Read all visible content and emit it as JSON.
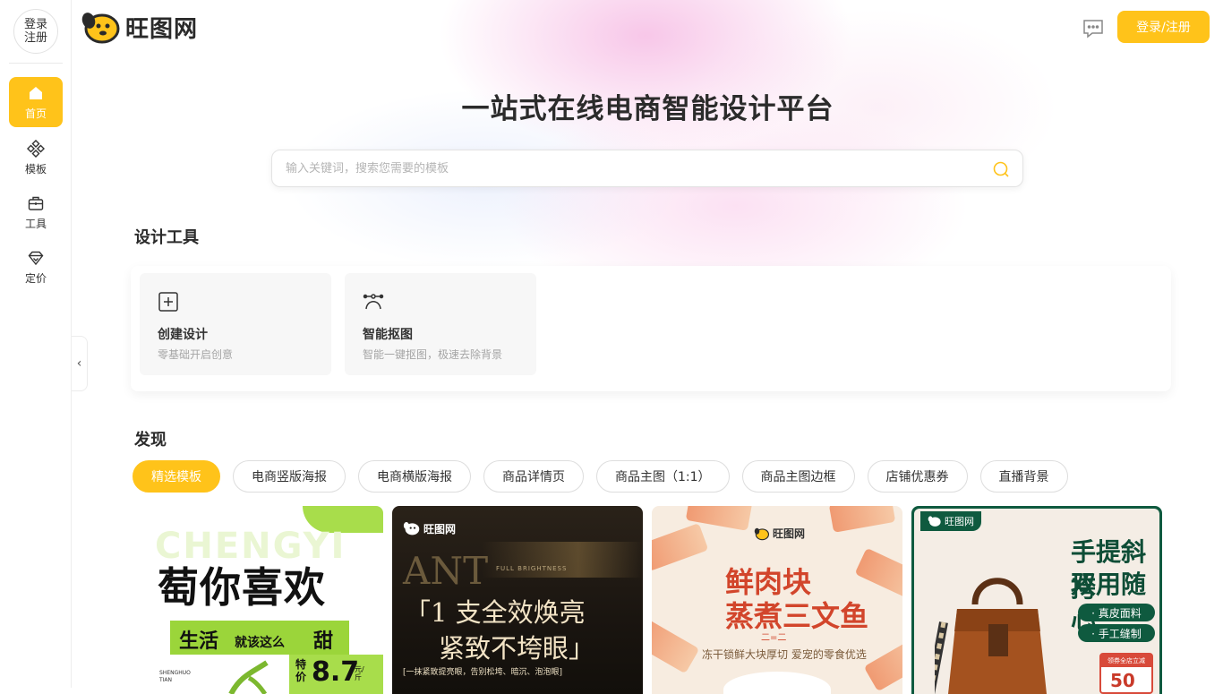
{
  "sidebar": {
    "login": {
      "line1": "登录",
      "line2": "注册"
    },
    "nav": [
      {
        "label": "首页",
        "icon": "home-icon",
        "active": true
      },
      {
        "label": "模板",
        "icon": "template-icon",
        "active": false
      },
      {
        "label": "工具",
        "icon": "toolbox-icon",
        "active": false
      },
      {
        "label": "定价",
        "icon": "diamond-icon",
        "active": false
      }
    ],
    "collapse_glyph": "‹"
  },
  "header": {
    "logo_text": "旺图网",
    "login_button": "登录/注册",
    "accent_color": "#ffc31a"
  },
  "hero": {
    "title": "一站式在线电商智能设计平台",
    "search_placeholder": "输入关键词，搜索您需要的模板"
  },
  "tools": {
    "title": "设计工具",
    "items": [
      {
        "name": "创建设计",
        "desc": "零基础开启创意",
        "icon": "plus-square-icon"
      },
      {
        "name": "智能抠图",
        "desc": "智能一键抠图，极速去除背景",
        "icon": "bezier-pen-icon"
      }
    ]
  },
  "discover": {
    "title": "发现",
    "chips": [
      {
        "label": "精选模板",
        "active": true
      },
      {
        "label": "电商竖版海报",
        "active": false
      },
      {
        "label": "电商横版海报",
        "active": false
      },
      {
        "label": "商品详情页",
        "active": false
      },
      {
        "label": "商品主图（1:1）",
        "active": false
      },
      {
        "label": "商品主图边框",
        "active": false
      },
      {
        "label": "店铺优惠券",
        "active": false
      },
      {
        "label": "直播背景",
        "active": false
      }
    ],
    "cards": {
      "c1": {
        "bg_letters": "CHENGYI",
        "headline": "萄你喜欢",
        "band_main": "生活",
        "band_small": "就该这么",
        "band_sweet": "甜",
        "price_label": "特价",
        "price": "8.7",
        "unit": "元/斤",
        "sig": "SHENGHUO\nTIAN"
      },
      "c2": {
        "brand": "旺图网",
        "ant": "ANT",
        "fb": "FULL BRIGHTNESS",
        "line1": "「1 支全效焕亮",
        "line2": "紧致不垮眼」",
        "line3": "[一抹紧致提亮眼，告别松垮、暗沉、泡泡眼]"
      },
      "c3": {
        "brand": "旺图网",
        "line1": "鲜肉块",
        "line2": "蒸煮三文鱼",
        "dash": "二=二",
        "sub": "冻干锁鲜大块厚切 爱宠的零食优选"
      },
      "c4": {
        "brand": "旺图网",
        "line1": "手提斜挎",
        "line2": "双用随心",
        "tag1": "· 真皮面料",
        "tag2": "· 手工缝制",
        "coupon_title": "领券全店立减",
        "coupon_value": "50"
      }
    }
  }
}
